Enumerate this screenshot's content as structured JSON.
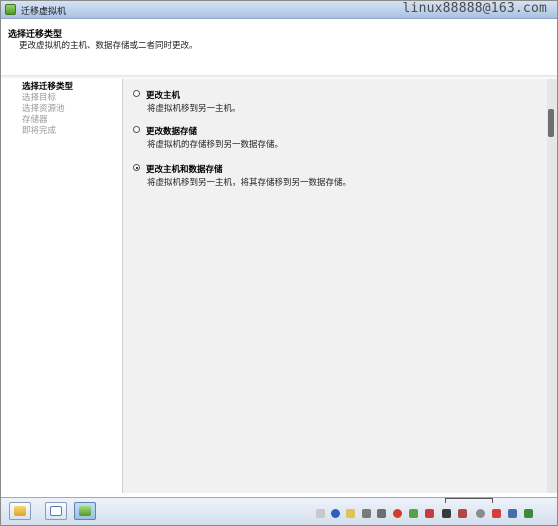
{
  "window": {
    "title": "迁移虚拟机",
    "watermark": "linux88888@163.com"
  },
  "header": {
    "title": "选择迁移类型",
    "subtitle": "更改虚拟机的主机、数据存储或二者同时更改。"
  },
  "nav": {
    "items": [
      {
        "label": "选择迁移类型",
        "active": true
      },
      {
        "label": "选择目标",
        "active": false
      },
      {
        "label": "选择资源池",
        "active": false
      },
      {
        "label": "存储器",
        "active": false
      },
      {
        "label": "即将完成",
        "active": false
      }
    ]
  },
  "options": [
    {
      "label": "更改主机",
      "description": "将虚拟机移到另一主机。",
      "selected": false
    },
    {
      "label": "更改数据存储",
      "description": "将虚拟机的存储移到另一数据存储。",
      "selected": false
    },
    {
      "label": "更改主机和数据存储",
      "description": "将虚拟机移到另一主机，将其存储移到另一数据存储。",
      "selected": true
    }
  ],
  "taskbar": {
    "buttons": [
      "start-folder-icon",
      "window-icon",
      "vmware-icon"
    ],
    "tray_icons": [
      "keyboard-icon",
      "help-icon",
      "folder-icon",
      "usb-icon",
      "power-icon",
      "network-icon",
      "volume-icon",
      "display-icon",
      "mute-icon",
      "security-icon",
      "clock-icon",
      "monitor-icon",
      "task-icon"
    ]
  },
  "colors": {
    "content_bg": "#f1f1f1",
    "titlebar": "#bcd0ea",
    "scrollbar_thumb": "#6f6f6f"
  }
}
